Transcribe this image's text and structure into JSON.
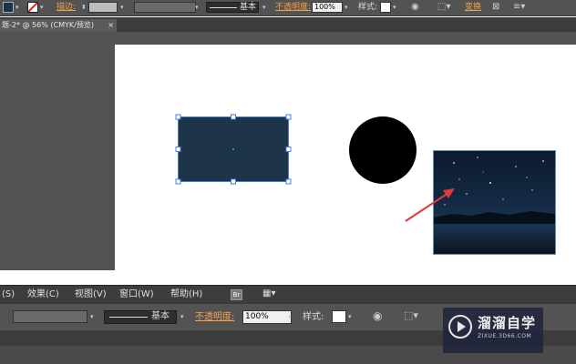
{
  "top_control_bar": {
    "stroke_label": "描边:",
    "brush_style": "基本",
    "opacity_label": "不透明度:",
    "opacity_value": "100%",
    "style_label": "样式:",
    "transform_label": "变换"
  },
  "document_tab": {
    "title": "题-2* @ 56% (CMYK/预览)",
    "close_glyph": "×"
  },
  "canvas": {
    "shapes": [
      {
        "name": "rectangle",
        "fill": "#1e3449",
        "selected": true
      },
      {
        "name": "circle",
        "fill": "#000000"
      },
      {
        "name": "night-sky-photo"
      }
    ],
    "arrow_color": "#e03a3a",
    "selection_color": "#4a7fd8"
  },
  "menu_bar": {
    "items": [
      "(S)",
      "效果(C)",
      "视图(V)",
      "窗口(W)",
      "帮助(H)"
    ],
    "bridge_label": "Br"
  },
  "bottom_control_bar": {
    "brush_style": "基本",
    "opacity_label": "不透明度:",
    "opacity_value": "100%",
    "style_label": "样式:"
  },
  "watermark": {
    "name": "溜溜自学",
    "url": "ZIXUE.3D66.COM"
  }
}
